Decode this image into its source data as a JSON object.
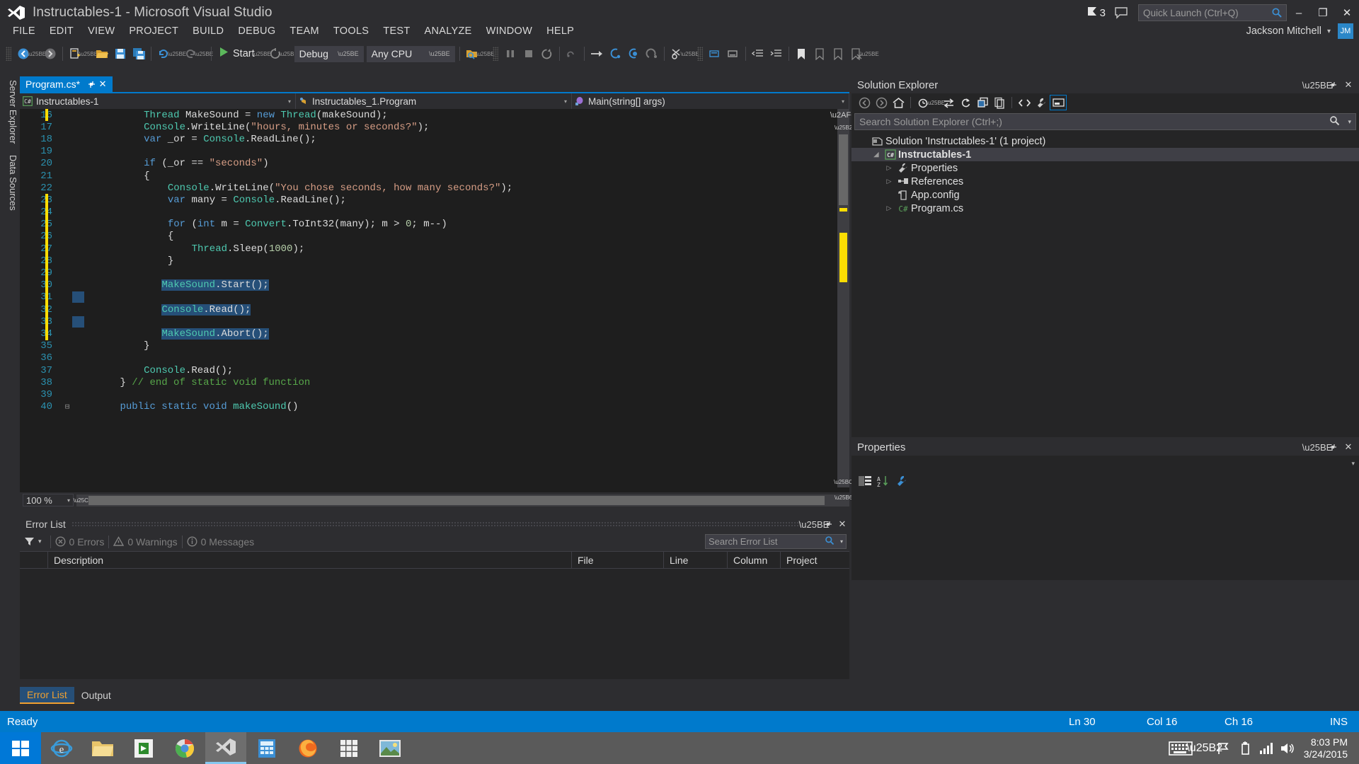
{
  "window": {
    "title": "Instructables-1 - Microsoft Visual Studio",
    "logo_icon": "visual-studio-logo",
    "notification_count": "3",
    "notification_icon": "flag-icon",
    "feedback_icon": "feedback-balloon-icon",
    "minimize_label": "–",
    "restore_label": "❐",
    "close_label": "✕"
  },
  "quick_launch": {
    "placeholder": "Quick Launch (Ctrl+Q)",
    "value": "",
    "search_icon": "search-icon"
  },
  "menu": {
    "items": [
      {
        "label": "FILE"
      },
      {
        "label": "EDIT"
      },
      {
        "label": "VIEW"
      },
      {
        "label": "PROJECT"
      },
      {
        "label": "BUILD"
      },
      {
        "label": "DEBUG"
      },
      {
        "label": "TEAM"
      },
      {
        "label": "TOOLS"
      },
      {
        "label": "TEST"
      },
      {
        "label": "ANALYZE"
      },
      {
        "label": "WINDOW"
      },
      {
        "label": "HELP"
      }
    ],
    "user_name": "Jackson Mitchell",
    "user_initials": "JM",
    "user_caret": "▾"
  },
  "toolbar": {
    "nav_back_icon": "navigate-back-icon",
    "nav_forward_icon": "navigate-forward-icon",
    "new_project_icon": "new-project-icon",
    "open_file_icon": "open-file-icon",
    "save_icon": "save-icon",
    "save_all_icon": "save-all-icon",
    "undo_icon": "undo-icon",
    "redo_icon": "redo-icon",
    "start_icon": "start-play-icon",
    "start_label": "Start",
    "restart_icon": "restart-icon",
    "config_value": "Debug",
    "platform_value": "Any CPU",
    "find_icon": "find-in-files-icon",
    "pause_icon": "pause-icon",
    "stop_icon": "stop-icon",
    "restart_debug_icon": "restart-debug-icon",
    "show_next_statement_icon": "show-next-statement-icon",
    "step_into_icon": "step-into-icon",
    "step_over_icon": "step-over-icon",
    "step_out_icon": "step-out-icon",
    "breakpoints_icon": "breakpoints-icon",
    "comment_icon": "comment-selection-icon",
    "uncomment_icon": "uncomment-selection-icon",
    "indent_icon": "increase-indent-icon",
    "outdent_icon": "decrease-indent-icon",
    "bookmark_icon": "bookmark-icon",
    "prev_bookmark_icon": "previous-bookmark-icon",
    "next_bookmark_icon": "next-bookmark-icon",
    "clear_bookmark_icon": "clear-bookmarks-icon",
    "overflow_icon": "toolbar-overflow-icon"
  },
  "left_dock": {
    "tabs": [
      "Server Explorer",
      "Data Sources"
    ]
  },
  "editor": {
    "tab_label": "Program.cs*",
    "tab_pin_icon": "pin-icon",
    "tab_close_icon": "close-icon",
    "nav": {
      "project": "Instructables-1",
      "project_icon": "csharp-project-icon",
      "type": "Instructables_1.Program",
      "type_icon": "class-icon",
      "member": "Main(string[] args)",
      "member_icon": "method-icon",
      "caret": "▾"
    },
    "zoom_level": "100 %",
    "zoom_caret": "▾",
    "lines": [
      {
        "num": "16",
        "indent": 12,
        "marker": "changed",
        "tokens": [
          {
            "c": "t",
            "s": "Thread"
          },
          {
            "c": "p",
            "s": " MakeSound = "
          },
          {
            "c": "k",
            "s": "new"
          },
          {
            "c": "p",
            "s": " "
          },
          {
            "c": "t",
            "s": "Thread"
          },
          {
            "c": "p",
            "s": "(makeSound);"
          }
        ]
      },
      {
        "num": "17",
        "indent": 12,
        "marker": "none",
        "tokens": [
          {
            "c": "t",
            "s": "Console"
          },
          {
            "c": "p",
            "s": ".WriteLine("
          },
          {
            "c": "s",
            "s": "\"hours, minutes or seconds?\""
          },
          {
            "c": "p",
            "s": ");"
          }
        ]
      },
      {
        "num": "18",
        "indent": 12,
        "marker": "none",
        "tokens": [
          {
            "c": "k",
            "s": "var"
          },
          {
            "c": "p",
            "s": " _or = "
          },
          {
            "c": "t",
            "s": "Console"
          },
          {
            "c": "p",
            "s": ".ReadLine();"
          }
        ]
      },
      {
        "num": "19",
        "indent": 0,
        "marker": "none",
        "tokens": []
      },
      {
        "num": "20",
        "indent": 12,
        "marker": "none",
        "tokens": [
          {
            "c": "k",
            "s": "if"
          },
          {
            "c": "p",
            "s": " (_or == "
          },
          {
            "c": "s",
            "s": "\"seconds\""
          },
          {
            "c": "p",
            "s": ")"
          }
        ]
      },
      {
        "num": "21",
        "indent": 12,
        "marker": "none",
        "tokens": [
          {
            "c": "p",
            "s": "{"
          }
        ]
      },
      {
        "num": "22",
        "indent": 16,
        "marker": "none",
        "tokens": [
          {
            "c": "t",
            "s": "Console"
          },
          {
            "c": "p",
            "s": ".WriteLine("
          },
          {
            "c": "s",
            "s": "\"You chose seconds, how many seconds?\""
          },
          {
            "c": "p",
            "s": ");"
          }
        ]
      },
      {
        "num": "23",
        "indent": 16,
        "marker": "changed",
        "tokens": [
          {
            "c": "k",
            "s": "var"
          },
          {
            "c": "p",
            "s": " many = "
          },
          {
            "c": "t",
            "s": "Console"
          },
          {
            "c": "p",
            "s": ".ReadLine();"
          }
        ]
      },
      {
        "num": "24",
        "indent": 0,
        "marker": "changed",
        "tokens": []
      },
      {
        "num": "25",
        "indent": 16,
        "marker": "changed",
        "tokens": [
          {
            "c": "k",
            "s": "for"
          },
          {
            "c": "p",
            "s": " ("
          },
          {
            "c": "k",
            "s": "int"
          },
          {
            "c": "p",
            "s": " m = "
          },
          {
            "c": "t",
            "s": "Convert"
          },
          {
            "c": "p",
            "s": ".ToInt32(many); m > "
          },
          {
            "c": "n",
            "s": "0"
          },
          {
            "c": "p",
            "s": "; m--)"
          }
        ]
      },
      {
        "num": "26",
        "indent": 16,
        "marker": "changed",
        "tokens": [
          {
            "c": "p",
            "s": "{"
          }
        ]
      },
      {
        "num": "27",
        "indent": 20,
        "marker": "changed",
        "tokens": [
          {
            "c": "t",
            "s": "Thread"
          },
          {
            "c": "p",
            "s": ".Sleep("
          },
          {
            "c": "n",
            "s": "1000"
          },
          {
            "c": "p",
            "s": ");"
          }
        ]
      },
      {
        "num": "28",
        "indent": 16,
        "marker": "changed",
        "tokens": [
          {
            "c": "p",
            "s": "}"
          }
        ]
      },
      {
        "num": "29",
        "indent": 0,
        "marker": "changed",
        "tokens": []
      },
      {
        "num": "30",
        "indent": 15,
        "marker": "changed",
        "selected": true,
        "tokens": [
          {
            "c": "t",
            "s": "MakeSound"
          },
          {
            "c": "p",
            "s": ".Start();"
          }
        ]
      },
      {
        "num": "31",
        "indent": 0,
        "marker": "changed",
        "selected": true,
        "tokens": []
      },
      {
        "num": "32",
        "indent": 15,
        "marker": "changed",
        "selected": true,
        "tokens": [
          {
            "c": "t",
            "s": "Console"
          },
          {
            "c": "p",
            "s": ".Read();"
          }
        ]
      },
      {
        "num": "33",
        "indent": 0,
        "marker": "changed",
        "selected": true,
        "tokens": []
      },
      {
        "num": "34",
        "indent": 15,
        "marker": "changed",
        "selected": true,
        "tokens": [
          {
            "c": "t",
            "s": "MakeSound"
          },
          {
            "c": "p",
            "s": ".Abort();"
          }
        ]
      },
      {
        "num": "35",
        "indent": 12,
        "marker": "none",
        "tokens": [
          {
            "c": "p",
            "s": "}"
          }
        ]
      },
      {
        "num": "36",
        "indent": 0,
        "marker": "none",
        "tokens": []
      },
      {
        "num": "37",
        "indent": 12,
        "marker": "none",
        "tokens": [
          {
            "c": "t",
            "s": "Console"
          },
          {
            "c": "p",
            "s": ".Read();"
          }
        ]
      },
      {
        "num": "38",
        "indent": 8,
        "marker": "none",
        "tokens": [
          {
            "c": "p",
            "s": "} "
          },
          {
            "c": "c",
            "s": "// end of static void function"
          }
        ]
      },
      {
        "num": "39",
        "indent": 0,
        "marker": "none",
        "tokens": []
      },
      {
        "num": "40",
        "indent": 8,
        "marker": "none",
        "collapse": "⊟",
        "tokens": [
          {
            "c": "k",
            "s": "public static void"
          },
          {
            "c": "p",
            "s": " "
          },
          {
            "c": "t",
            "s": "makeSound"
          },
          {
            "c": "p",
            "s": "()"
          }
        ]
      }
    ]
  },
  "error_list": {
    "title": "Error List",
    "minimize_icon": "dropdown-icon",
    "pin_icon": "pin-icon",
    "close_icon": "close-icon",
    "filter_icon": "filter-icon",
    "filter_caret": "▾",
    "errors_label": "0 Errors",
    "errors_icon": "error-circle-icon",
    "warnings_label": "0 Warnings",
    "warnings_icon": "warning-triangle-icon",
    "messages_label": "0 Messages",
    "messages_icon": "info-circle-icon",
    "search_placeholder": "Search Error List",
    "search_icon": "search-icon",
    "search_caret": "▾",
    "columns": [
      "Description",
      "File",
      "Line",
      "Column",
      "Project"
    ],
    "rows": [],
    "tabs": [
      {
        "label": "Error List",
        "selected": true
      },
      {
        "label": "Output",
        "selected": false
      }
    ]
  },
  "solution_explorer": {
    "title": "Solution Explorer",
    "minimize_icon": "dropdown-icon",
    "pin_icon": "pin-icon",
    "close_icon": "close-icon",
    "toolbar_icons": [
      "back-icon",
      "forward-icon",
      "home-icon",
      "pending-changes-icon",
      "sync-with-active-document-icon",
      "refresh-icon",
      "collapse-all-icon",
      "show-all-files-icon",
      "view-code-icon",
      "properties-icon",
      "preview-selected-items-icon"
    ],
    "search_placeholder": "Search Solution Explorer (Ctrl+;)",
    "search_icon": "search-icon",
    "search_caret": "▾",
    "tree": [
      {
        "label": "Solution 'Instructables-1' (1 project)",
        "icon": "solution-icon",
        "depth": 0,
        "arrow": "",
        "selected": false
      },
      {
        "label": "Instructables-1",
        "icon": "csharp-project-icon",
        "depth": 1,
        "arrow": "◢",
        "selected": true
      },
      {
        "label": "Properties",
        "icon": "properties-wrench-icon",
        "depth": 2,
        "arrow": "▷",
        "selected": false
      },
      {
        "label": "References",
        "icon": "references-icon",
        "depth": 2,
        "arrow": "▷",
        "selected": false
      },
      {
        "label": "App.config",
        "icon": "config-file-icon",
        "depth": 2,
        "arrow": "",
        "selected": false
      },
      {
        "label": "Program.cs",
        "icon": "csharp-file-icon",
        "depth": 2,
        "arrow": "▷",
        "selected": false
      }
    ]
  },
  "properties_panel": {
    "title": "Properties",
    "minimize_icon": "dropdown-icon",
    "pin_icon": "pin-icon",
    "close_icon": "close-icon",
    "selector_value": "",
    "selector_caret": "▾",
    "toolbar_icons": [
      "categorized-icon",
      "alphabetical-icon",
      "property-pages-icon"
    ]
  },
  "status_bar": {
    "message": "Ready",
    "line": "Ln 30",
    "column": "Col 16",
    "character": "Ch 16",
    "insert_mode": "INS"
  },
  "taskbar": {
    "start_icon": "windows-start-icon",
    "apps": [
      {
        "icon": "internet-explorer-icon",
        "active": false
      },
      {
        "icon": "file-explorer-icon",
        "active": false
      },
      {
        "icon": "store-icon",
        "active": false
      },
      {
        "icon": "chrome-icon",
        "active": false
      },
      {
        "icon": "visual-studio-icon",
        "active": true
      },
      {
        "icon": "calculator-icon",
        "active": false
      },
      {
        "icon": "firefox-icon",
        "active": false
      },
      {
        "icon": "apps-grid-icon",
        "active": false
      },
      {
        "icon": "photos-icon",
        "active": false
      }
    ],
    "tray_icons": [
      "keyboard-icon",
      "show-hidden-icons-icon",
      "flag-action-center-icon",
      "battery-icon",
      "network-signal-icon",
      "volume-icon"
    ],
    "time": "8:03 PM",
    "date": "3/24/2015"
  }
}
